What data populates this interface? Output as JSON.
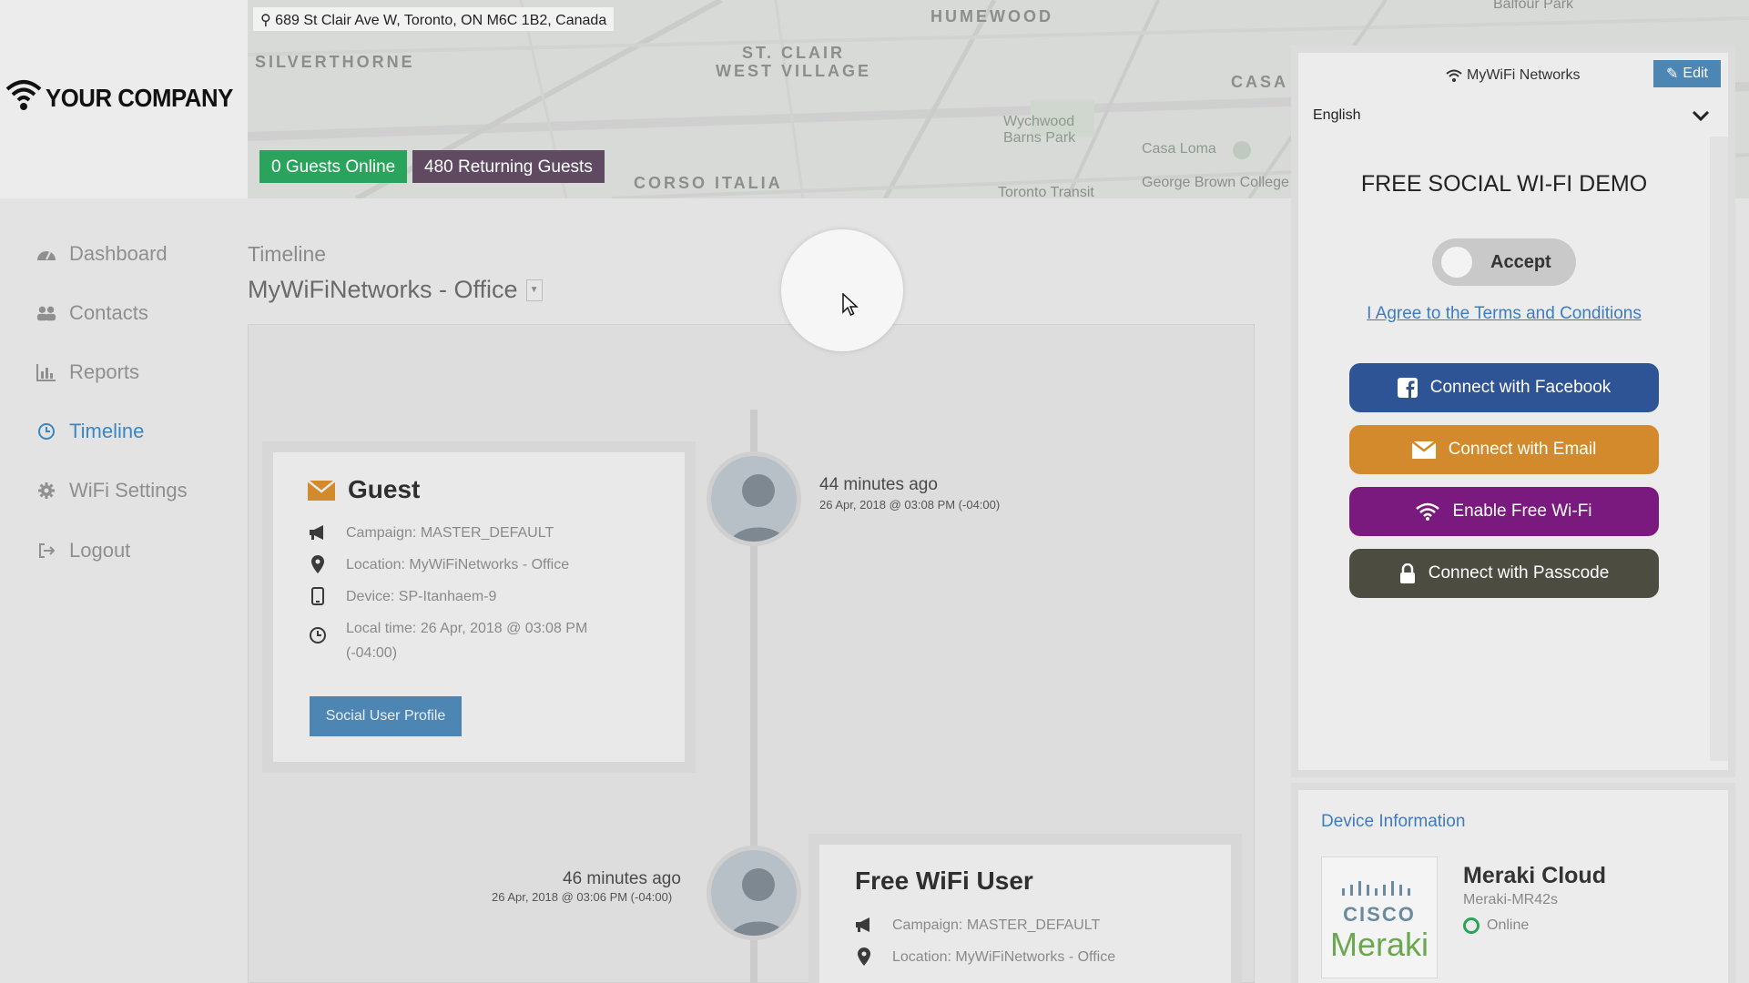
{
  "brand": {
    "name": "YOUR COMPANY",
    "icon": "wifi-icon"
  },
  "map": {
    "address": "689 St Clair Ave W, Toronto, ON M6C 1B2, Canada",
    "labels": {
      "humewood": "HUMEWOOD",
      "silverthorne": "SILVERTHORNE",
      "st_clair_1": "ST. CLAIR",
      "st_clair_2": "WEST VILLAGE",
      "casa": "CASA",
      "corso_italia": "CORSO ITALIA",
      "wychwood_1": "Wychwood",
      "wychwood_2": "Barns Park",
      "casa_loma": "Casa Loma",
      "george_brown": "George Brown College",
      "toronto_transit": "Toronto Transit",
      "balfour": "Balfour Park"
    }
  },
  "stats": {
    "guests_online": "0 Guests Online",
    "returning_guests": "480 Returning Guests"
  },
  "sidebar": {
    "items": [
      {
        "label": "Dashboard",
        "icon": "dashboard-icon"
      },
      {
        "label": "Contacts",
        "icon": "users-icon"
      },
      {
        "label": "Reports",
        "icon": "bar-chart-icon"
      },
      {
        "label": "Timeline",
        "icon": "clock-icon",
        "active": true
      },
      {
        "label": "WiFi Settings",
        "icon": "gear-icon"
      },
      {
        "label": "Logout",
        "icon": "logout-icon"
      }
    ]
  },
  "main": {
    "breadcrumb": "Timeline",
    "location": "MyWiFiNetworks - Office"
  },
  "timeline": {
    "entries": [
      {
        "title": "Guest",
        "campaign": "Campaign: MASTER_DEFAULT",
        "location": "Location: MyWiFiNetworks - Office",
        "device": "Device: SP-Itanhaem-9",
        "local_time": "Local time: 26 Apr, 2018 @ 03:08 PM (-04:00)",
        "button": "Social User Profile",
        "ago": "44 minutes ago",
        "timestamp": "26 Apr, 2018 @ 03:08 PM (-04:00)"
      },
      {
        "title": "Free WiFi User",
        "campaign": "Campaign: MASTER_DEFAULT",
        "location": "Location: MyWiFiNetworks - Office",
        "ago": "46 minutes ago",
        "timestamp": "26 Apr, 2018 @ 03:06 PM (-04:00)"
      }
    ]
  },
  "splash": {
    "network": "MyWiFi Networks",
    "edit": "Edit",
    "language": "English",
    "title": "FREE SOCIAL WI-FI DEMO",
    "accept": "Accept",
    "terms": "I Agree to the Terms and Conditions",
    "buttons": [
      {
        "label": "Connect with Facebook",
        "color": "#2f5496",
        "icon": "facebook-icon"
      },
      {
        "label": "Connect with Email",
        "color": "#d38a2c",
        "icon": "envelope-icon"
      },
      {
        "label": "Enable Free Wi-Fi",
        "color": "#7a1a7e",
        "icon": "wifi-icon"
      },
      {
        "label": "Connect with Passcode",
        "color": "#4c4c40",
        "icon": "lock-icon"
      }
    ]
  },
  "device": {
    "title": "Device Information",
    "logo_line1": "CISCO",
    "logo_line2": "Meraki",
    "name": "Meraki Cloud",
    "model": "Meraki-MR42s",
    "status": "Online"
  },
  "colors": {
    "accent": "#3b87c1",
    "online_badge": "#2aa35c",
    "returning_badge": "#5f4a62",
    "status_online": "#2aa35c"
  }
}
